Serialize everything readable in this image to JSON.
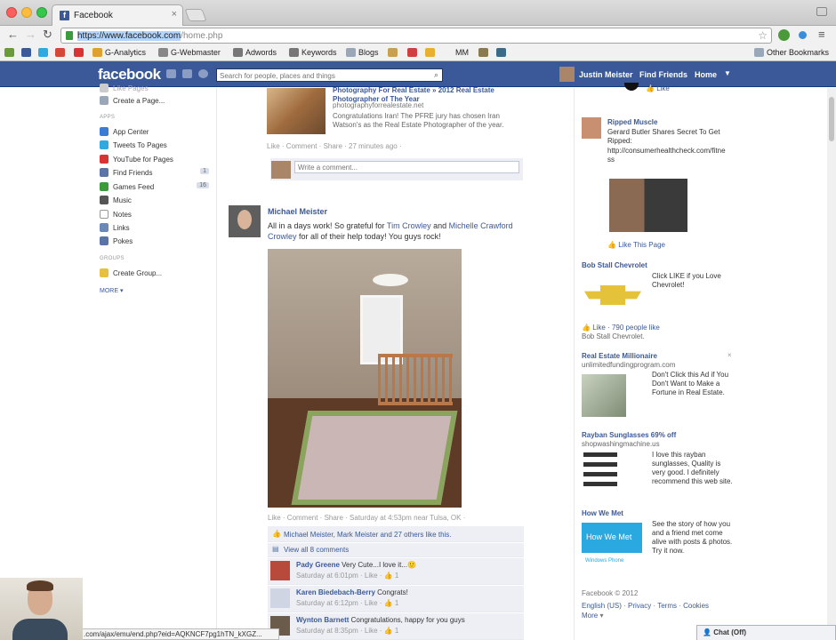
{
  "browser": {
    "tab_title": "Facebook",
    "tab_close": "×",
    "url_selected": "https://www.facebook.com",
    "url_path": "/home.php",
    "bookmarks": [
      "G-Analytics",
      "G-Webmaster",
      "Adwords",
      "Keywords",
      "Blogs",
      "MM"
    ],
    "other_bookmarks": "Other Bookmarks",
    "status_url": ".com/ajax/emu/end.php?eid=AQKNCF7pg1hTN_kXGZ..."
  },
  "fb": {
    "logo": "facebook",
    "search_placeholder": "Search for people, places and things",
    "user_name": "Justin Meister",
    "nav": [
      "Find Friends",
      "Home"
    ]
  },
  "sidebar": {
    "partial_top": "Like Pages",
    "create_page": "Create a Page...",
    "apps_header": "APPS",
    "apps": [
      {
        "label": "App Center",
        "color": "#3a7bd5"
      },
      {
        "label": "Tweets To Pages",
        "color": "#2fa9e0"
      },
      {
        "label": "YouTube for Pages",
        "color": "#d93434"
      },
      {
        "label": "Find Friends",
        "color": "#5b74a8",
        "count": "1"
      },
      {
        "label": "Games Feed",
        "color": "#3a9b3a",
        "count": "16"
      },
      {
        "label": "Music",
        "color": "#555555"
      },
      {
        "label": "Notes",
        "color": "#dddddd"
      },
      {
        "label": "Links",
        "color": "#6a88b8"
      },
      {
        "label": "Pokes",
        "color": "#5b74a8"
      }
    ],
    "groups_header": "GROUPS",
    "create_group": "Create Group...",
    "more": "MORE"
  },
  "feed": {
    "shared_link": {
      "title": "Photography For Real Estate » 2012 Real Estate Photographer of The Year",
      "domain": "photographyforrealestate.net",
      "description": "Congratulations Iran! The PFRE jury has chosen Iran Watson's as the Real Estate Photographer of the year.",
      "meta": "Like · Comment · Share · 27 minutes ago ·"
    },
    "comment_placeholder": "Write a comment...",
    "post": {
      "author": "Michael Meister",
      "text_pre": "All in a days work! So grateful for ",
      "tag1": "Tim Crowley",
      "text_mid": " and ",
      "tag2": "Michelle Crawford Crowley",
      "text_post": " for all of their help today! You guys rock!",
      "meta": "Like · Comment · Share · Saturday at 4:53pm near Tulsa, OK ·",
      "likes": "Michael Meister, Mark Meister and 27 others like this.",
      "view_comments": "View all 8 comments",
      "comments": [
        {
          "name": "Pady Greene",
          "text": "Very Cute...I love it...",
          "emoji": "🙂",
          "time": "Saturday at 6:01pm · Like · 👍 1",
          "avatar": "#b84a3b"
        },
        {
          "name": "Karen Biedebach-Berry",
          "text": "Congrats!",
          "emoji": "",
          "time": "Saturday at 6:12pm · Like · 👍 1",
          "avatar": "#cfd5e3"
        },
        {
          "name": "Wynton Barnett",
          "text": "Congratulations, happy for you guys",
          "emoji": "",
          "time": "Saturday at 8:35pm · Like · 👍 1",
          "avatar": "#6b5b4b"
        }
      ]
    }
  },
  "ads": {
    "partial_like": "Like",
    "ripped": {
      "title": "Ripped Muscle",
      "text": "Gerard Butler Shares Secret To Get Ripped:",
      "url": "http://consumerhealthcheck.com/fitness",
      "like": "Like This Page"
    },
    "chevrolet": {
      "title": "Bob Stall Chevrolet",
      "text": "Click LIKE if you Love Chevrolet!",
      "like_line": "Like · 790 people like",
      "like_line2": "Bob Stall Chevrolet."
    },
    "millionaire": {
      "title": "Real Estate Millionaire",
      "domain": "unlimitedfundingprogram.com",
      "text": "Don't Click this Ad if You Don't Want to Make a Fortune in Real Estate.",
      "close": "×"
    },
    "rayban": {
      "title": "Rayban Sunglasses 69% off",
      "domain": "shopwashingmachine.us",
      "text": "I love this rayban sunglasses, Quality is very good. I definitely recommend this web site."
    },
    "howwemet": {
      "title": "How We Met",
      "text": "See the story of how you and a friend met come alive with posts & photos. Try it now.",
      "img_label": "How We Met",
      "img_sub": "Windows Phone"
    }
  },
  "footer": {
    "copyright": "Facebook © 2012",
    "links": [
      "English (US)",
      "Privacy",
      "Terms",
      "Cookies",
      "More"
    ]
  },
  "chat": {
    "label": "Chat (Off)"
  }
}
